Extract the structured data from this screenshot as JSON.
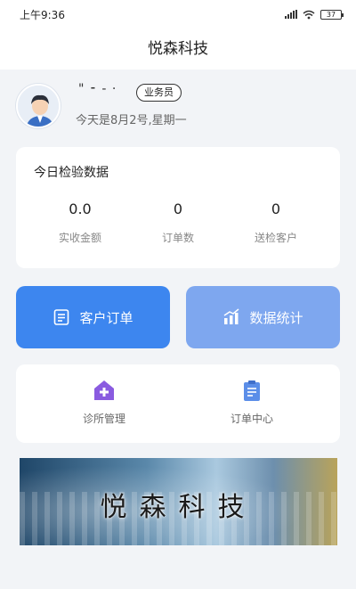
{
  "status_bar": {
    "time": "上午9:36",
    "battery": "37"
  },
  "header": {
    "title": "悦森科技"
  },
  "profile": {
    "name": "\" ⁃ ‐ ·",
    "role": "业务员",
    "date_text": "今天是8月2号,星期一"
  },
  "stats": {
    "title": "今日检验数据",
    "items": [
      {
        "value": "0.0",
        "label": "实收金额"
      },
      {
        "value": "0",
        "label": "订单数"
      },
      {
        "value": "0",
        "label": "送检客户"
      }
    ]
  },
  "actions": {
    "orders_label": "客户订单",
    "stats_label": "数据统计"
  },
  "grid": {
    "items": [
      {
        "label": "诊所管理",
        "icon": "clinic-plus-icon"
      },
      {
        "label": "订单中心",
        "icon": "clipboard-icon"
      }
    ]
  },
  "banner": {
    "text": "悦森科技"
  },
  "colors": {
    "primary": "#3d86ef",
    "secondary": "#7ea7ef",
    "purple": "#8a5be0",
    "icon_blue": "#5b8ee8"
  }
}
